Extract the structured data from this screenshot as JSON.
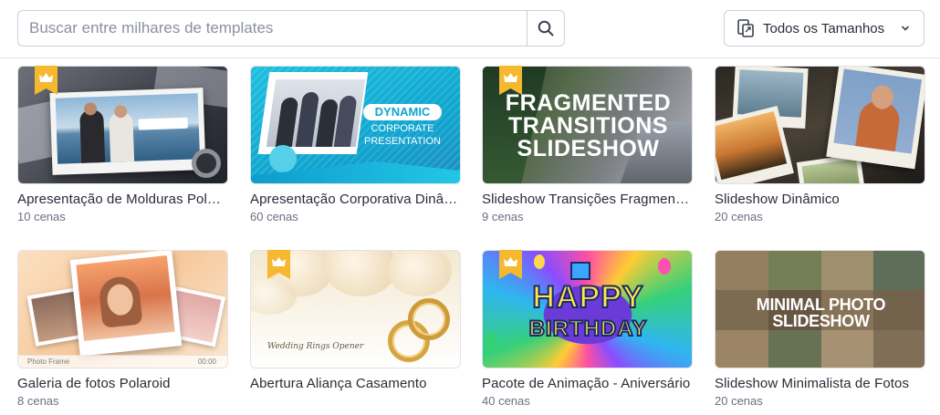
{
  "search": {
    "placeholder": "Buscar entre milhares de templates",
    "button_icon": "search-icon"
  },
  "size_filter": {
    "icon": "resize-icon",
    "selected": "Todos os Tamanhos",
    "chevron_icon": "chevron-down-icon"
  },
  "premium_icon": "crown-icon",
  "accent_color": "#f5b82e",
  "templates": [
    {
      "title": "Apresentação de Molduras Polaroid",
      "scenes": "10 cenas",
      "premium": true
    },
    {
      "title": "Apresentação Corporativa Dinâmica",
      "scenes": "60 cenas",
      "premium": false,
      "thumb_text": {
        "line1": "DYNAMIC",
        "line2": "CORPORATE",
        "line3": "PRESENTATION"
      }
    },
    {
      "title": "Slideshow Transições Fragmentadas",
      "scenes": "9 cenas",
      "premium": true,
      "thumb_text": {
        "line1": "FRAGMENTED",
        "line2": "TRANSITIONS",
        "line3": "SLIDESHOW"
      }
    },
    {
      "title": "Slideshow Dinâmico",
      "scenes": "20 cenas",
      "premium": false
    },
    {
      "title": "Galeria de fotos Polaroid",
      "scenes": "8 cenas",
      "premium": false,
      "thumb_text": {
        "caption": "Photo Frame",
        "time": "00:00"
      }
    },
    {
      "title": "Abertura Aliança Casamento",
      "scenes": "",
      "premium": true,
      "thumb_text": {
        "caption": "Wedding Rings Opener"
      }
    },
    {
      "title": "Pacote de Animação - Aniversário",
      "scenes": "40 cenas",
      "premium": true,
      "thumb_text": {
        "line1": "HAPPY",
        "line2": "BIRTHDAY"
      }
    },
    {
      "title": "Slideshow Minimalista de Fotos",
      "scenes": "20 cenas",
      "premium": false,
      "thumb_text": {
        "line1": "MINIMAL PHOTO SLIDESHOW"
      }
    }
  ]
}
